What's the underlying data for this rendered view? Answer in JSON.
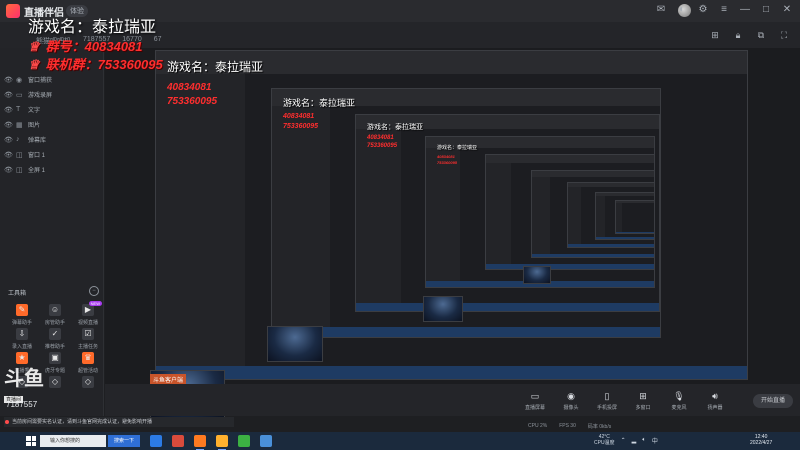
{
  "app": {
    "title": "直播伴侣",
    "version": "体验"
  },
  "header": {
    "room_category": "熊猫吧吧机",
    "room_id": "7187557",
    "hot": "16770",
    "fans": "67"
  },
  "overlay": {
    "game_name": "游戏名：泰拉瑞亚",
    "qq_group_label": "群号：",
    "qq_group_value": "40834081",
    "qq_link_label": "联机群：",
    "qq_link_value": "753360095"
  },
  "sources": [
    {
      "icon": "camera",
      "label": "窗口捕获"
    },
    {
      "icon": "monitor",
      "label": "游戏录屏"
    },
    {
      "icon": "text",
      "label": "文字"
    },
    {
      "icon": "image",
      "label": "图片"
    },
    {
      "icon": "music",
      "label": "弹幕库"
    },
    {
      "icon": "window",
      "label": "窗口 1"
    },
    {
      "icon": "window",
      "label": "全屏 1"
    }
  ],
  "tools": {
    "title": "工具箱",
    "items": [
      {
        "label": "弹幕助手",
        "hot": true,
        "badge": ""
      },
      {
        "label": "房管助手",
        "hot": false,
        "badge": ""
      },
      {
        "label": "视频直播",
        "hot": false,
        "badge": "NEW"
      },
      {
        "label": "录入直播",
        "hot": false,
        "badge": ""
      },
      {
        "label": "推荐助手",
        "hot": false,
        "badge": ""
      },
      {
        "label": "主播任务",
        "hot": false,
        "badge": ""
      },
      {
        "label": "直播秀",
        "hot": true,
        "badge": ""
      },
      {
        "label": "虎牙专题",
        "hot": false,
        "badge": ""
      },
      {
        "label": "超管活动",
        "hot": true,
        "badge": ""
      },
      {
        "label": "",
        "hot": false,
        "badge": ""
      },
      {
        "label": "",
        "hot": false,
        "badge": ""
      },
      {
        "label": "",
        "hot": false,
        "badge": ""
      }
    ]
  },
  "branding": {
    "logo_text": "斗鱼",
    "logo_sub": "直播间",
    "room_id": "7187557"
  },
  "preview": {
    "thumb_title": "斗鱼客户端"
  },
  "controls": {
    "items": [
      {
        "icon": "screen-capture",
        "label": "直播屏幕"
      },
      {
        "icon": "camera",
        "label": "摄像头"
      },
      {
        "icon": "phone",
        "label": "手机投屏"
      },
      {
        "icon": "multi",
        "label": "多窗口"
      },
      {
        "icon": "mic",
        "label": "麦克风"
      },
      {
        "icon": "speaker",
        "label": "扬声器"
      }
    ],
    "start_label": "开始直播"
  },
  "stats": {
    "cpu": "CPU 2%",
    "fps": "FPS 30",
    "bitrate": "码率 0kb/s"
  },
  "notice": "当前房间需要实名认证，请到斗鱼官网完成认证，避免影响开播",
  "taskbar": {
    "search_placeholder": "输入你想搜的",
    "search_button": "搜索一下",
    "weather_temp": "42°C",
    "weather_desc": "CPU温度",
    "time": "12:40",
    "date": "2022/4/27",
    "apps": [
      {
        "name": "edge",
        "color": "#2c7be5"
      },
      {
        "name": "chrome",
        "color": "#d94b3c"
      },
      {
        "name": "douyu",
        "color": "#ff7a21",
        "active": true
      },
      {
        "name": "live-companion",
        "color": "#ffb02e",
        "active": true
      },
      {
        "name": "wechat",
        "color": "#3cb043"
      },
      {
        "name": "folder",
        "color": "#4a90d9"
      }
    ]
  },
  "colors": {
    "accent": "#ff6a2a",
    "overlay_red": "#ff2e2e",
    "panel": "#232428",
    "taskbar": "#1b2a3d"
  }
}
